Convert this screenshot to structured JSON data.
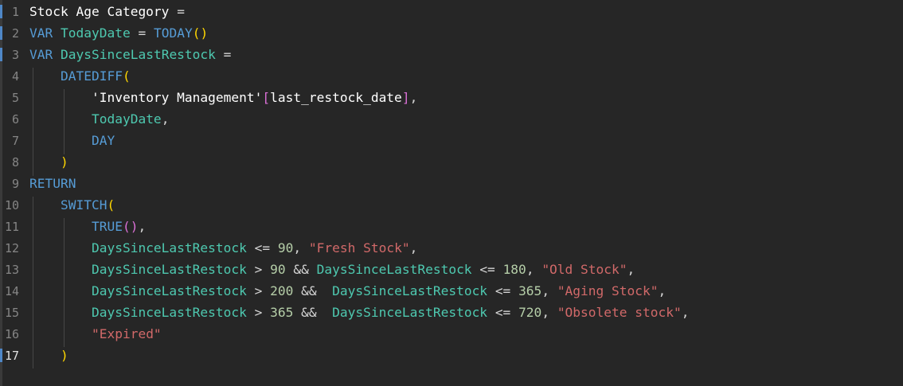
{
  "editor": {
    "lines": [
      {
        "number": "1",
        "tokens": {
          "measure_name": "Stock Age Category",
          "eq": "="
        }
      },
      {
        "number": "2",
        "tokens": {
          "kw": "VAR",
          "name": "TodayDate",
          "eq": "=",
          "fn": "TODAY",
          "open": "(",
          "close": ")"
        }
      },
      {
        "number": "3",
        "tokens": {
          "kw": "VAR",
          "name": "DaysSinceLastRestock",
          "eq": "="
        }
      },
      {
        "number": "4",
        "tokens": {
          "fn": "DATEDIFF",
          "open": "("
        }
      },
      {
        "number": "5",
        "tokens": {
          "table": "'Inventory Management'",
          "open": "[",
          "column": "last_restock_date",
          "close": "]",
          "comma": ","
        }
      },
      {
        "number": "6",
        "tokens": {
          "var": "TodayDate",
          "comma": ","
        }
      },
      {
        "number": "7",
        "tokens": {
          "kw": "DAY"
        }
      },
      {
        "number": "8",
        "tokens": {
          "close": ")"
        }
      },
      {
        "number": "9",
        "tokens": {
          "kw": "RETURN"
        }
      },
      {
        "number": "10",
        "tokens": {
          "fn": "SWITCH",
          "open": "("
        }
      },
      {
        "number": "11",
        "tokens": {
          "fn": "TRUE",
          "parens": "()",
          "comma": ","
        }
      },
      {
        "number": "12",
        "tokens": {
          "var": "DaysSinceLastRestock",
          "op": "<=",
          "num": "90",
          "comma": ",",
          "str": "\"Fresh Stock\"",
          "comma2": ","
        }
      },
      {
        "number": "13",
        "tokens": {
          "var": "DaysSinceLastRestock",
          "op": ">",
          "num": "90",
          "and": "&&",
          "var2": "DaysSinceLastRestock",
          "op2": "<=",
          "num2": "180",
          "comma": ",",
          "str": "\"Old Stock\"",
          "comma2": ","
        }
      },
      {
        "number": "14",
        "tokens": {
          "var": "DaysSinceLastRestock",
          "op": ">",
          "num": "200",
          "and": "&&",
          "var2": "DaysSinceLastRestock",
          "op2": "<=",
          "num2": "365",
          "comma": ",",
          "str": "\"Aging Stock\"",
          "comma2": ","
        }
      },
      {
        "number": "15",
        "tokens": {
          "var": "DaysSinceLastRestock",
          "op": ">",
          "num": "365",
          "and": "&&",
          "var2": "DaysSinceLastRestock",
          "op2": "<=",
          "num2": "720",
          "comma": ",",
          "str": "\"Obsolete stock\"",
          "comma2": ","
        }
      },
      {
        "number": "16",
        "tokens": {
          "str": "\"Expired\""
        }
      },
      {
        "number": "17",
        "tokens": {
          "close": ")"
        }
      }
    ],
    "active_line": "17"
  },
  "colors": {
    "background": "#262626",
    "keyword": "#569cd6",
    "variable": "#4ec9b0",
    "string": "#ce9178",
    "number": "#b5cea8",
    "paren_level1": "#ffd700",
    "paren_level2": "#da70d6"
  }
}
